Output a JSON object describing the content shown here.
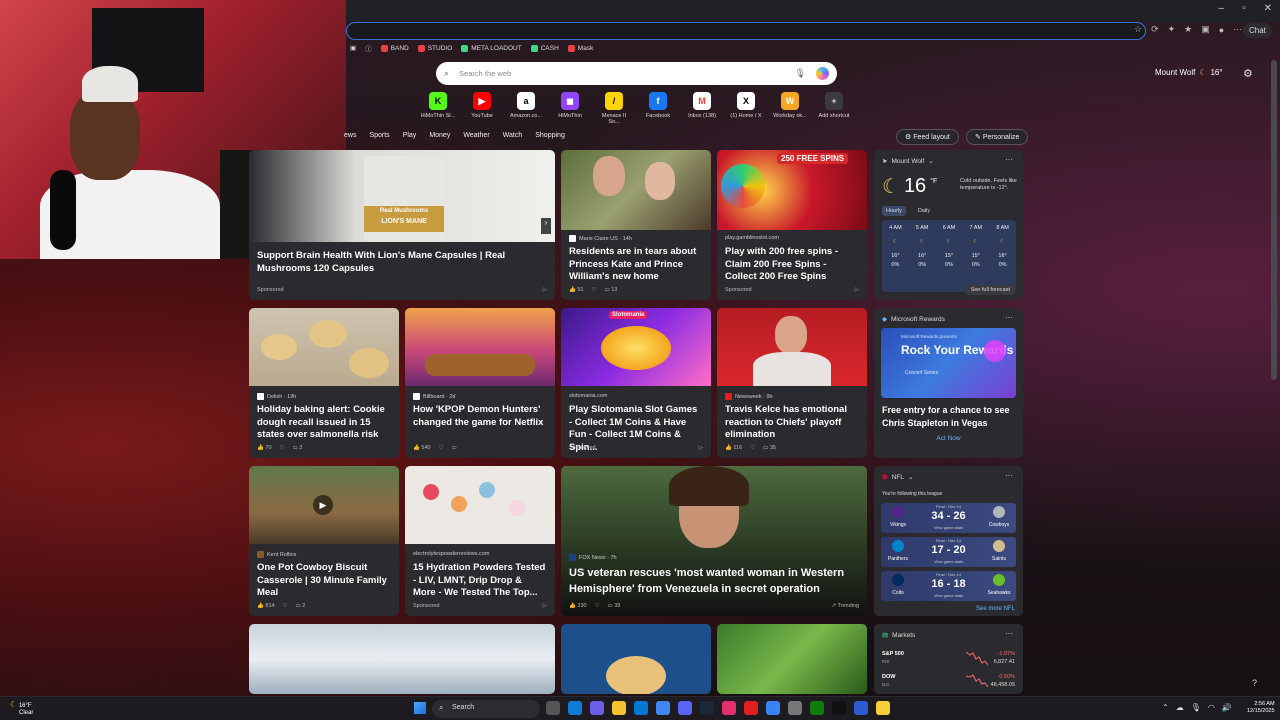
{
  "browser": {
    "copilot_label": "Chat",
    "bookmarks": [
      {
        "label": "BAND",
        "color": "#e84343"
      },
      {
        "label": "STUDIO",
        "color": "#e84343"
      },
      {
        "label": "META LOADOUT",
        "color": "#3ddc84"
      },
      {
        "label": "CASH",
        "color": "#3ddc84"
      },
      {
        "label": "Mask",
        "color": "#e84343"
      }
    ]
  },
  "search": {
    "placeholder": "Search the web"
  },
  "weather_top": {
    "location": "Mount Wolf",
    "temp": "16°"
  },
  "shortcuts": [
    {
      "label": "HiMoThin St...",
      "icon": "kick-icon",
      "glyph": "K",
      "bg": "#53fc18",
      "fg": "#000"
    },
    {
      "label": "YouTube",
      "icon": "youtube-icon",
      "glyph": "▶",
      "bg": "#ff0000",
      "fg": "#fff"
    },
    {
      "label": "Amazon.co...",
      "icon": "amazon-icon",
      "glyph": "a",
      "bg": "#fff",
      "fg": "#000"
    },
    {
      "label": "HiMoThin",
      "icon": "twitch-icon",
      "glyph": "◼",
      "bg": "#9146ff",
      "fg": "#fff"
    },
    {
      "label": "Menace II So...",
      "icon": "menace-icon",
      "glyph": "/",
      "bg": "#ffd400",
      "fg": "#000"
    },
    {
      "label": "Facebook",
      "icon": "facebook-icon",
      "glyph": "f",
      "bg": "#1877f2",
      "fg": "#fff"
    },
    {
      "label": "Inbox (138)",
      "icon": "gmail-icon",
      "glyph": "M",
      "bg": "#fff",
      "fg": "#ea4335"
    },
    {
      "label": "(1) Home / X",
      "icon": "x-icon",
      "glyph": "X",
      "bg": "#fff",
      "fg": "#000"
    },
    {
      "label": "Workday ok...",
      "icon": "workday-icon",
      "glyph": "W",
      "bg": "#f5a623",
      "fg": "#fff"
    },
    {
      "label": "Add shortcut",
      "icon": "add-icon",
      "glyph": "+",
      "bg": "#3a3a3f",
      "fg": "#ddd"
    }
  ],
  "nav": [
    "ews",
    "Sports",
    "Play",
    "Money",
    "Weather",
    "Watch",
    "Shopping"
  ],
  "feed_layout": "Feed layout",
  "personalize": "Personalize",
  "cards": [
    {
      "id": "c1",
      "source": "",
      "title": "Support Brain Health With Lion's Mane Capsules | Real Mushrooms 120 Capsules",
      "foot": "Sponsored",
      "likes": "",
      "comments": ""
    },
    {
      "id": "c2",
      "source": "Marie Claire US · 14h",
      "title": "Residents are in tears about Princess Kate and Prince William's new home",
      "foot": "",
      "likes": "91",
      "comments": "13"
    },
    {
      "id": "c3",
      "source": "play.gamblinoslot.com",
      "title": "Play with 200 free spins - Claim 200 Free Spins - Collect 200 Free Spins",
      "foot": "Sponsored",
      "likes": "",
      "comments": ""
    },
    {
      "id": "c4",
      "source": "Delish · 19h",
      "title": "Holiday baking alert: Cookie dough recall issued in 15 states over salmonella risk",
      "foot": "",
      "likes": "70",
      "comments": "3"
    },
    {
      "id": "c5",
      "source": "Billboard · 2d",
      "title": "How 'KPOP Demon Hunters' changed the game for Netflix",
      "foot": "",
      "likes": "540",
      "comments": ""
    },
    {
      "id": "c6",
      "source": "slotomania.com",
      "title": "Play Slotomania Slot Games - Collect 1M Coins & Have Fun - Collect 1M Coins & Spin...",
      "foot": "Sponsored",
      "likes": "",
      "comments": ""
    },
    {
      "id": "c7",
      "source": "Newsweek · 9h",
      "title": "Travis Kelce has emotional reaction to Chiefs' playoff elimination",
      "foot": "",
      "likes": "116",
      "comments": "35"
    },
    {
      "id": "c8",
      "source": "Kent Rollins",
      "title": "One Pot Cowboy Biscuit Casserole | 30 Minute Family Meal",
      "foot": "",
      "likes": "814",
      "comments": "2"
    },
    {
      "id": "c9",
      "source": "electrolytespowderreviews.com",
      "title": "15 Hydration Powders Tested - LIV, LMNT, Drip Drop & More - We Tested The Top...",
      "foot": "Sponsored",
      "likes": "",
      "comments": ""
    },
    {
      "id": "c10",
      "source": "FOX News · 7h",
      "title": "US veteran rescues 'most wanted woman in Western Hemisphere' from Venezuela in secret operation",
      "foot": "Trending",
      "likes": "330",
      "comments": "39"
    }
  ],
  "card_images": {
    "c1_label": "Real Mushrooms",
    "c1_product": "LION'S MANE",
    "c3_banner": "250 FREE SPINS",
    "c6_banner": "Slotomania"
  },
  "weather_widget": {
    "title": "Mount Wolf",
    "temp": "16",
    "unit": "°F",
    "note": "Cold outside. Feels like temperature is -12°.",
    "tab_hourly": "Hourly",
    "tab_daily": "Daily",
    "hours": [
      {
        "time": "4 AM",
        "temp": "16°",
        "precip": "0%"
      },
      {
        "time": "5 AM",
        "temp": "16°",
        "precip": "0%"
      },
      {
        "time": "6 AM",
        "temp": "15°",
        "precip": "0%"
      },
      {
        "time": "7 AM",
        "temp": "15°",
        "precip": "0%"
      },
      {
        "time": "8 AM",
        "temp": "16°",
        "precip": "0%"
      }
    ],
    "footer": "See full forecast"
  },
  "rewards": {
    "title": "Microsoft Rewards",
    "banner_small": "Microsoft Rewards presents",
    "banner_big": "Rock Your Rewards",
    "banner_sub": "Concert Series",
    "headline": "Free entry for a chance to see Chris Stapleton in Vegas",
    "action": "Act Now"
  },
  "nfl": {
    "title": "NFL",
    "subtitle": "You're following this league",
    "games": [
      {
        "status": "Final · Dec 14",
        "score": "34 - 26",
        "home": "Vikings",
        "away": "Cowboys",
        "link": "View game stats"
      },
      {
        "status": "Final · Dec 14",
        "score": "17 - 20",
        "home": "Panthers",
        "away": "Saints",
        "link": "View game stats"
      },
      {
        "status": "Final · Dec 14",
        "score": "16 - 18",
        "home": "Colts",
        "away": "Seahawks",
        "link": "View game stats"
      }
    ],
    "see_more": "See more NFL"
  },
  "markets": {
    "title": "Markets",
    "rows": [
      {
        "symbol": "S&P 500",
        "sub": "INX",
        "change": "-1.07%",
        "value": "6,827.41"
      },
      {
        "symbol": "DOW",
        "sub": "DJI",
        "change": "-0.50%",
        "value": "48,458.05"
      }
    ]
  },
  "taskbar": {
    "weather_temp": "16°F",
    "weather_desc": "Clear",
    "search": "Search",
    "time": "2:56 AM",
    "date": "12/15/2025"
  }
}
